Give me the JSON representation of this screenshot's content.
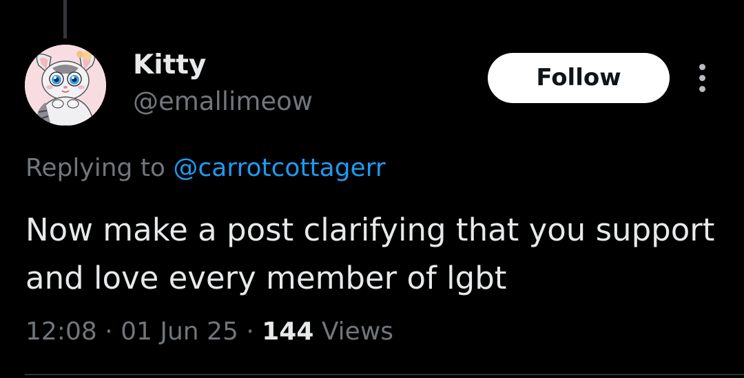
{
  "author": {
    "display_name": "Kitty",
    "handle": "@emallimeow",
    "avatar_icon": "cat-avatar-icon"
  },
  "actions": {
    "follow_label": "Follow",
    "more_icon": "more-vertical-icon"
  },
  "reply": {
    "prefix": "Replying to",
    "mention": "@carrotcottagerr"
  },
  "post": {
    "text": "Now make a post clarifying that you support and love every member of lgbt"
  },
  "meta": {
    "time": "12:08",
    "date": "01 Jun 25",
    "views_count": "144",
    "views_label": "Views",
    "separator": "·"
  },
  "colors": {
    "background": "#000000",
    "text_primary": "#e7e9ea",
    "text_secondary": "#71767b",
    "link": "#1d9bf0",
    "follow_bg": "#ffffff"
  }
}
